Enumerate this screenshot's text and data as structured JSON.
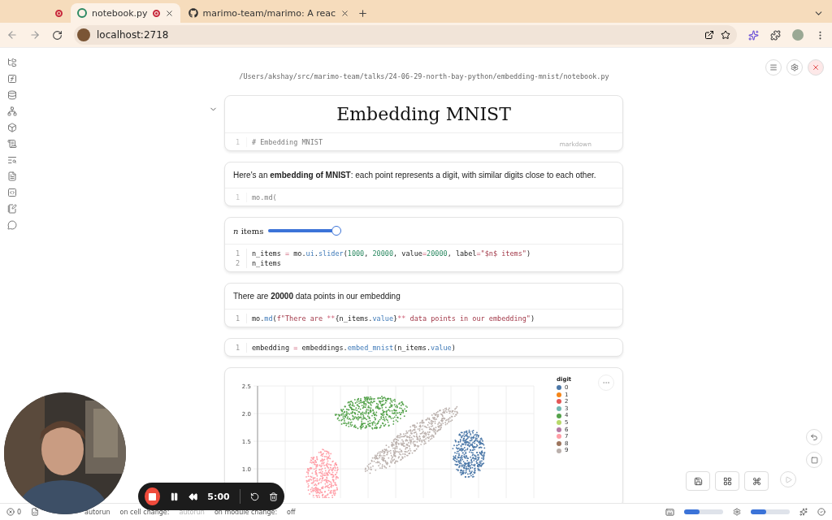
{
  "browser": {
    "tabs": [
      {
        "kind": "recording",
        "recording": true,
        "closable": false,
        "selected": false
      },
      {
        "kind": "marimo",
        "title": "notebook.py",
        "recording": true,
        "closable": true,
        "selected": true
      },
      {
        "kind": "github",
        "title": "marimo-team/marimo: A reac",
        "recording": false,
        "closable": true,
        "selected": false
      }
    ],
    "url": "localhost:2718"
  },
  "notebook": {
    "path": "/Users/akshay/src/marimo-team/talks/24-06-29-north-bay-python/embedding-mnist/notebook.py",
    "cells": [
      {
        "kind": "heading",
        "output": "Embedding MNIST",
        "editor": {
          "faded": true,
          "tag": "markdown",
          "lines": [
            {
              "number": "1",
              "tokens": [
                {
                  "text": "# Embedding MNIST",
                  "kind": "plain"
                }
              ]
            }
          ]
        }
      },
      {
        "kind": "text",
        "output": "Here's an **embedding of MNIST**: each point represents a digit, with similar digits close to each other.",
        "editor": {
          "faded": true,
          "lines": [
            {
              "number": "1",
              "tokens": [
                {
                  "text": "mo.md(",
                  "kind": "plain"
                }
              ]
            }
          ]
        }
      },
      {
        "kind": "slider",
        "label": "*n* items",
        "level": 1,
        "editor": {
          "faded": false,
          "lines": [
            {
              "number": "1",
              "tokens": [
                {
                  "text": "n_items",
                  "kind": "plain"
                },
                {
                  "text": " = ",
                  "kind": "op"
                },
                {
                  "text": "mo.",
                  "kind": "plain"
                },
                {
                  "text": "ui",
                  "kind": "attr"
                },
                {
                  "text": ".",
                  "kind": "plain"
                },
                {
                  "text": "slider",
                  "kind": "attr"
                },
                {
                  "text": "(",
                  "kind": "plain"
                },
                {
                  "text": "1000",
                  "kind": "num"
                },
                {
                  "text": ", ",
                  "kind": "plain"
                },
                {
                  "text": "20000",
                  "kind": "num"
                },
                {
                  "text": ", value",
                  "kind": "plain"
                },
                {
                  "text": "=",
                  "kind": "op"
                },
                {
                  "text": "20000",
                  "kind": "num"
                },
                {
                  "text": ", label",
                  "kind": "plain"
                },
                {
                  "text": "=",
                  "kind": "op"
                },
                {
                  "text": "\"$n$ items\"",
                  "kind": "str"
                },
                {
                  "text": ")",
                  "kind": "plain"
                }
              ]
            },
            {
              "number": "2",
              "tokens": [
                {
                  "text": "n_items",
                  "kind": "plain"
                }
              ]
            }
          ]
        }
      },
      {
        "kind": "text",
        "output": "There are **20000** data points in our embedding",
        "editor": {
          "faded": false,
          "lines": [
            {
              "number": "1",
              "tokens": [
                {
                  "text": "mo.",
                  "kind": "plain"
                },
                {
                  "text": "md",
                  "kind": "attr"
                },
                {
                  "text": "(",
                  "kind": "plain"
                },
                {
                  "text": "f\"There are ",
                  "kind": "str"
                },
                {
                  "text": "**",
                  "kind": "op"
                },
                {
                  "text": "{n_items.",
                  "kind": "plain"
                },
                {
                  "text": "value",
                  "kind": "attr"
                },
                {
                  "text": "}",
                  "kind": "plain"
                },
                {
                  "text": "**",
                  "kind": "op"
                },
                {
                  "text": " data points in our embedding\"",
                  "kind": "str"
                },
                {
                  "text": ")",
                  "kind": "plain"
                }
              ]
            }
          ]
        }
      },
      {
        "kind": "code",
        "editor": {
          "faded": false,
          "lines": [
            {
              "number": "1",
              "tokens": [
                {
                  "text": "embedding",
                  "kind": "plain"
                },
                {
                  "text": " = ",
                  "kind": "op"
                },
                {
                  "text": "embeddings.",
                  "kind": "plain"
                },
                {
                  "text": "embed_mnist",
                  "kind": "attr"
                },
                {
                  "text": "(n_items.",
                  "kind": "plain"
                },
                {
                  "text": "value",
                  "kind": "attr"
                },
                {
                  "text": ")",
                  "kind": "plain"
                }
              ]
            }
          ]
        }
      },
      {
        "kind": "plot",
        "yticks": [
          "2.5",
          "2.0",
          "1.5",
          "1.0"
        ],
        "legend_title": "digit",
        "legend": [
          {
            "label": "0",
            "color": "#4c78a8"
          },
          {
            "label": "1",
            "color": "#f58518"
          },
          {
            "label": "2",
            "color": "#e45756"
          },
          {
            "label": "3",
            "color": "#72b7b2"
          },
          {
            "label": "4",
            "color": "#54a24b"
          },
          {
            "label": "5",
            "color": "#b7d96a"
          },
          {
            "label": "6",
            "color": "#b279a2"
          },
          {
            "label": "7",
            "color": "#ff9da6"
          },
          {
            "label": "8",
            "color": "#9d755d"
          },
          {
            "label": "9",
            "color": "#bab0ac"
          }
        ]
      }
    ]
  },
  "recorder": {
    "time": "5:00"
  },
  "status_bar": {
    "errors": "0",
    "items": [
      {
        "text": "autorun",
        "faded": false
      },
      {
        "text": "on cell change:",
        "faded": false
      },
      {
        "text": "autorun",
        "faded": true
      },
      {
        "text": "on module change:",
        "faded": false
      },
      {
        "text": "off",
        "faded": false
      }
    ],
    "meters": [
      {
        "level": 0.4
      },
      {
        "level": 0.4
      }
    ]
  }
}
